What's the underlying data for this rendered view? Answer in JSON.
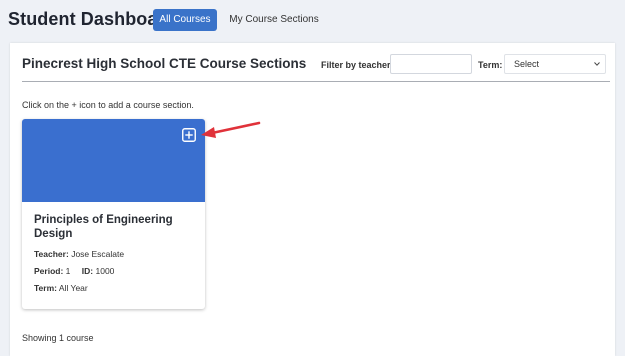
{
  "header": {
    "title": "Student Dashboard",
    "tabs": [
      {
        "label": "All Courses",
        "active": true
      },
      {
        "label": "My Course Sections",
        "active": false
      }
    ]
  },
  "panel": {
    "title": "Pinecrest High School CTE Course Sections",
    "filter_label": "Filter by teacher:",
    "filter_value": "",
    "term_label": "Term:",
    "term_selected": "Select",
    "instruction": "Click on the + icon to add a course section.",
    "footer": "Showing 1 course"
  },
  "cards": [
    {
      "title": "Principles of Engineering Design",
      "teacher_label": "Teacher:",
      "teacher": "Jose Escalate",
      "period_label": "Period:",
      "period": "1",
      "id_label": "ID:",
      "id": "1000",
      "term_label": "Term:",
      "term": "All Year"
    }
  ],
  "icons": {
    "add": "plus-square-icon",
    "select": "chevron-down-icon",
    "callout": "red-arrow-annotation"
  },
  "colors": {
    "primary": "#3a73c9",
    "card_banner": "#3a6fcf",
    "annotation": "#e0323a",
    "background": "#eef1f6"
  }
}
